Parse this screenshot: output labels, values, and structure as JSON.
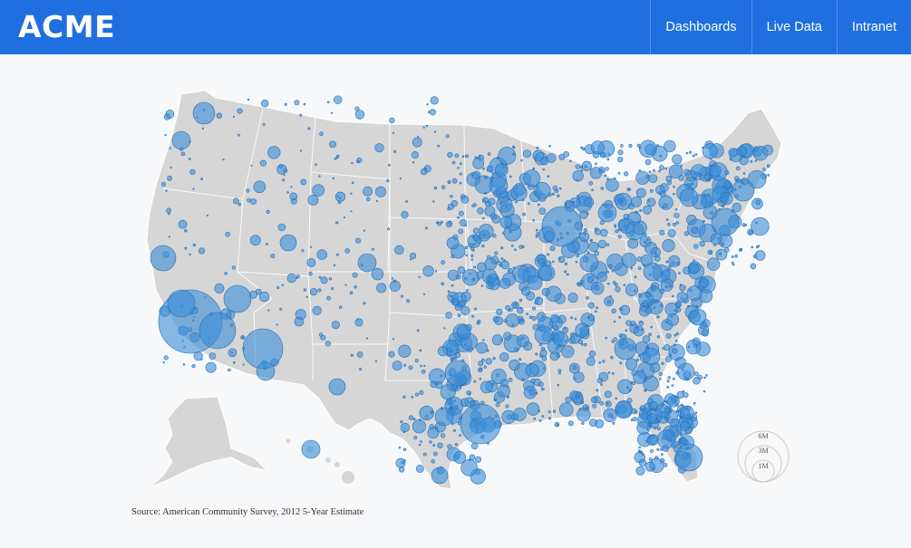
{
  "header": {
    "brand": "ACME",
    "nav": [
      "Dashboards",
      "Live Data",
      "Intranet"
    ]
  },
  "map": {
    "land_color": "#d6d6d6",
    "border_color": "#ffffff",
    "bubble_fill": "#3a8dd8",
    "bubble_stroke": "#2a6fb5",
    "legend": {
      "labels": [
        "6M",
        "3M",
        "1M"
      ]
    },
    "source": "Source: American Community Survey, 2012 5-Year Estimate"
  }
}
